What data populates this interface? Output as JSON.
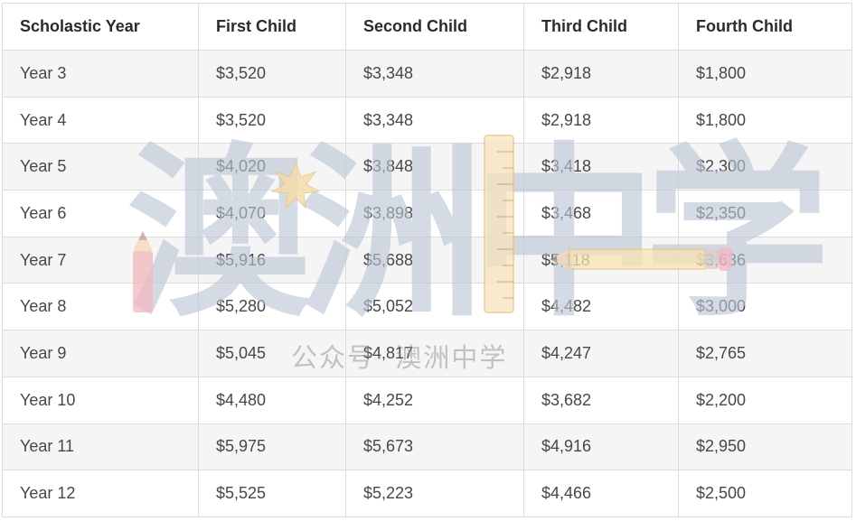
{
  "table": {
    "headers": [
      "Scholastic Year",
      "First Child",
      "Second Child",
      "Third Child",
      "Fourth Child"
    ],
    "rows": [
      [
        "Year 3",
        "$3,520",
        "$3,348",
        "$2,918",
        "$1,800"
      ],
      [
        "Year 4",
        "$3,520",
        "$3,348",
        "$2,918",
        "$1,800"
      ],
      [
        "Year 5",
        "$4,020",
        "$3,848",
        "$3,418",
        "$2,300"
      ],
      [
        "Year 6",
        "$4,070",
        "$3,898",
        "$3,468",
        "$2,350"
      ],
      [
        "Year 7",
        "$5,916",
        "$5,688",
        "$5,118",
        "$3,636"
      ],
      [
        "Year 8",
        "$5,280",
        "$5,052",
        "$4,482",
        "$3,000"
      ],
      [
        "Year 9",
        "$5,045",
        "$4,817",
        "$4,247",
        "$2,765"
      ],
      [
        "Year 10",
        "$4,480",
        "$4,252",
        "$3,682",
        "$2,200"
      ],
      [
        "Year 11",
        "$5,975",
        "$5,673",
        "$4,916",
        "$2,950"
      ],
      [
        "Year 12",
        "$5,525",
        "$5,223",
        "$4,466",
        "$2,500"
      ]
    ]
  },
  "watermark": {
    "logo_text": "澳洲中学",
    "caption": "公众号· 澳洲中学"
  }
}
